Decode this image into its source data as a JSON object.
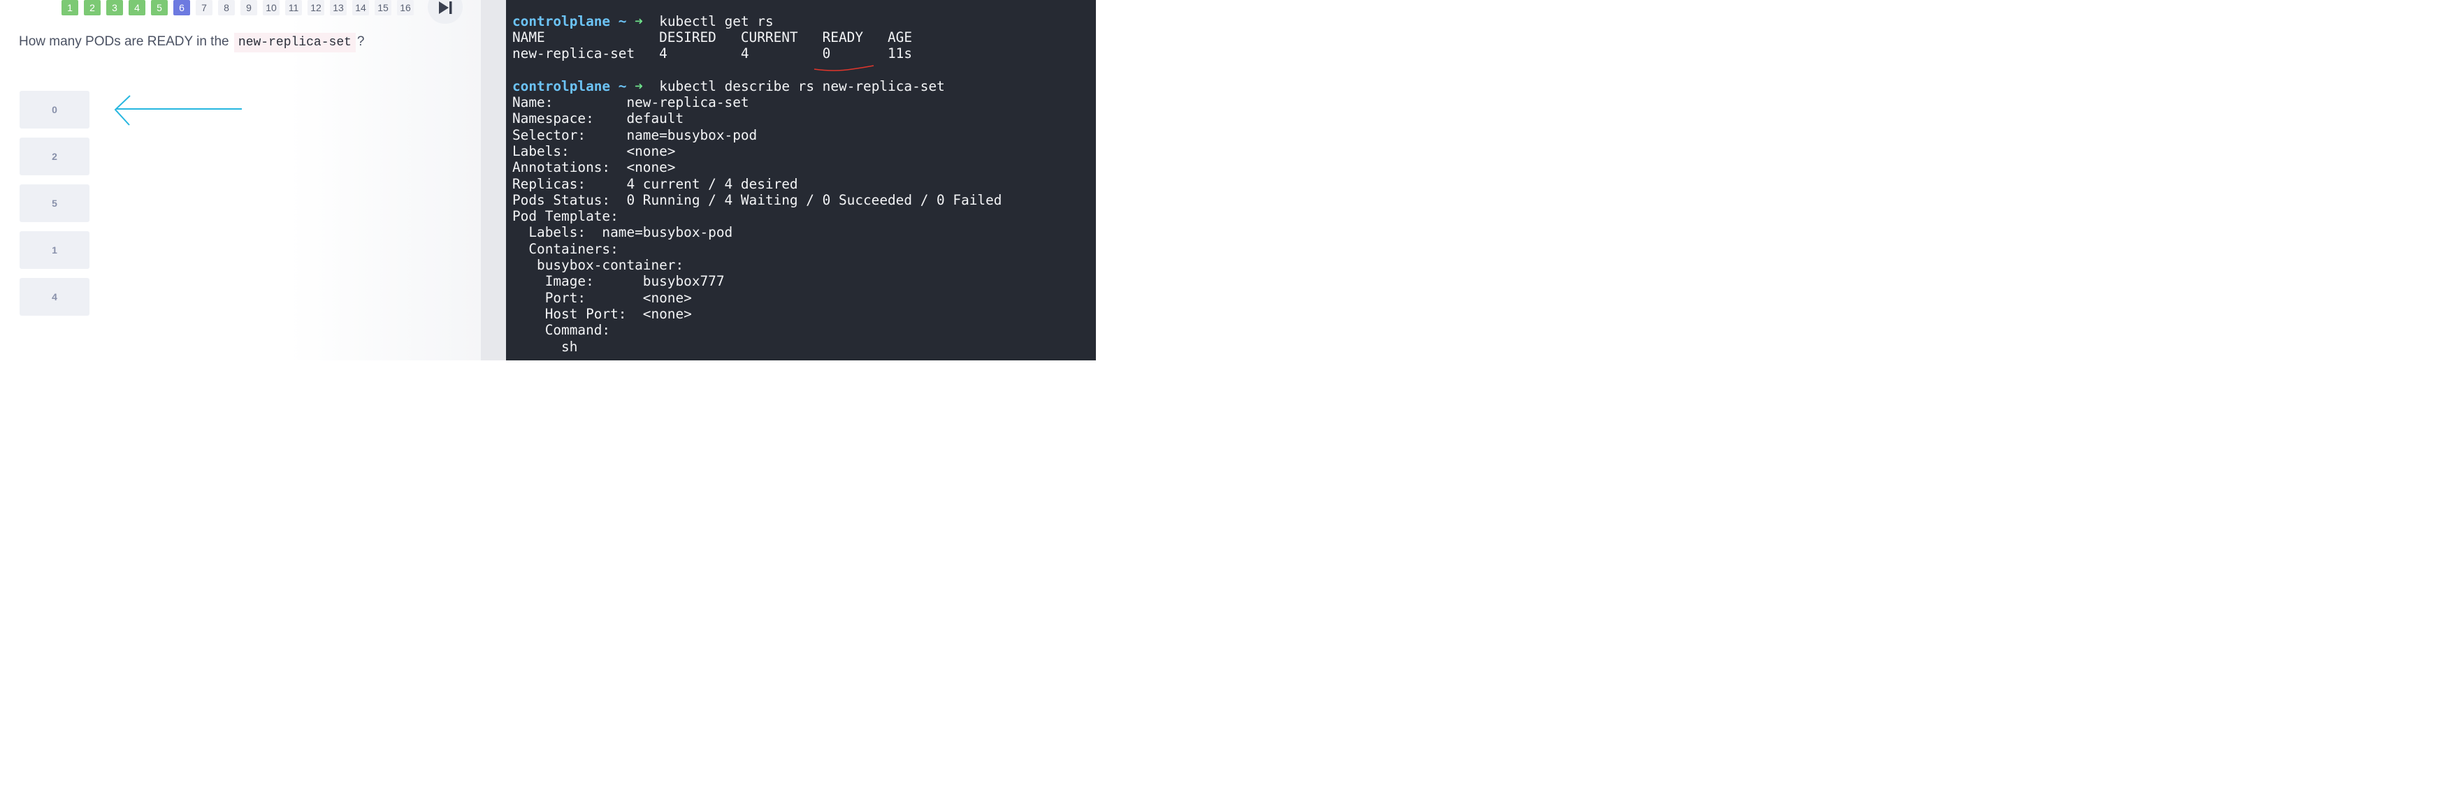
{
  "quiz": {
    "nav_items": [
      {
        "num": "1",
        "state": "done"
      },
      {
        "num": "2",
        "state": "done"
      },
      {
        "num": "3",
        "state": "done"
      },
      {
        "num": "4",
        "state": "done"
      },
      {
        "num": "5",
        "state": "done"
      },
      {
        "num": "6",
        "state": "current"
      },
      {
        "num": "7",
        "state": "pending"
      },
      {
        "num": "8",
        "state": "pending"
      },
      {
        "num": "9",
        "state": "pending"
      },
      {
        "num": "10",
        "state": "pending"
      },
      {
        "num": "11",
        "state": "pending"
      },
      {
        "num": "12",
        "state": "pending"
      },
      {
        "num": "13",
        "state": "pending"
      },
      {
        "num": "14",
        "state": "pending"
      },
      {
        "num": "15",
        "state": "pending"
      },
      {
        "num": "16",
        "state": "pending"
      }
    ],
    "question_prefix": "How many PODs are READY in the",
    "question_code": "new-replica-set",
    "question_suffix": "?",
    "options": [
      "0",
      "2",
      "5",
      "1",
      "4"
    ],
    "skip_icon": "skip-forward-icon",
    "colors": {
      "done": "#7cc974",
      "current": "#6d7ae0",
      "annotation": "#27b7e0"
    }
  },
  "terminal": {
    "prompt_host": "controlplane",
    "prompt_dir": "~",
    "prompt_arrow": "➜",
    "cmd1": "kubectl get rs",
    "table_header": "NAME              DESIRED   CURRENT   READY   AGE",
    "table_row": "new-replica-set   4         4         0       11s",
    "cmd2": "kubectl describe rs new-replica-set",
    "describe_lines": [
      "Name:         new-replica-set",
      "Namespace:    default",
      "Selector:     name=busybox-pod",
      "Labels:       <none>",
      "Annotations:  <none>",
      "Replicas:     4 current / 4 desired",
      "Pods Status:  0 Running / 4 Waiting / 0 Succeeded / 0 Failed",
      "Pod Template:",
      "  Labels:  name=busybox-pod",
      "  Containers:",
      "   busybox-container:",
      "    Image:      busybox777",
      "    Port:       <none>",
      "    Host Port:  <none>",
      "    Command:",
      "      sh"
    ],
    "colors": {
      "background": "#262a33",
      "prompt": "#6cc3f5",
      "arrow": "#6ee08a",
      "underline": "#e0362c"
    }
  }
}
